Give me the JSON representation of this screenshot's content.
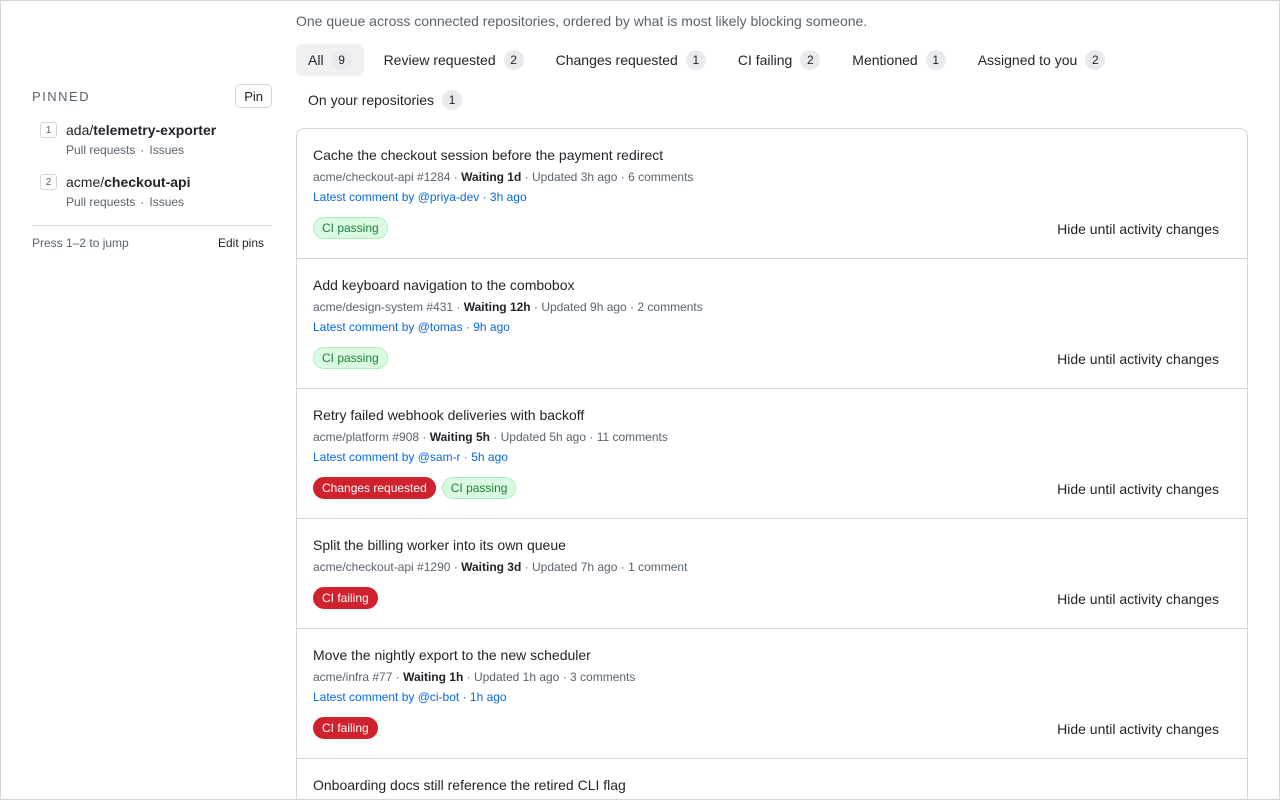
{
  "header": {
    "subtitle": "One queue across connected repositories, ordered by what is most likely blocking someone."
  },
  "tabs": [
    {
      "label": "All",
      "count": "9",
      "active": true
    },
    {
      "label": "Review requested",
      "count": "2"
    },
    {
      "label": "Changes requested",
      "count": "1"
    },
    {
      "label": "CI failing",
      "count": "2"
    },
    {
      "label": "Mentioned",
      "count": "1"
    },
    {
      "label": "Assigned to you",
      "count": "2"
    },
    {
      "label": "On your repositories",
      "count": "1"
    }
  ],
  "sidebar": {
    "pinned_title": "PINNED",
    "pin_button": "Pin",
    "items": [
      {
        "number": "1",
        "owner": "ada/",
        "name": "telemetry-exporter",
        "link1": "Pull requests",
        "sep": "·",
        "link2": "Issues"
      },
      {
        "number": "2",
        "owner": "acme/",
        "name": "checkout-api",
        "link1": "Pull requests",
        "sep": "·",
        "link2": "Issues"
      }
    ],
    "jump_hint": "Press 1–2 to jump",
    "edit_pins": "Edit pins"
  },
  "queue": {
    "hide_label": "Hide until activity changes",
    "items": [
      {
        "title": "Cache the checkout session before the payment redirect",
        "repo": "acme/checkout-api #1284",
        "waiting": "Waiting 1d",
        "updated": "Updated 3h ago",
        "comments": "6 comments",
        "latest": "Latest comment by @priya-dev · 3h ago",
        "badges": [
          {
            "label": "CI passing",
            "kind": "pass"
          }
        ]
      },
      {
        "title": "Add keyboard navigation to the combobox",
        "repo": "acme/design-system #431",
        "waiting": "Waiting 12h",
        "updated": "Updated 9h ago",
        "comments": "2 comments",
        "latest": "Latest comment by @tomas · 9h ago",
        "badges": [
          {
            "label": "CI passing",
            "kind": "pass"
          }
        ]
      },
      {
        "title": "Retry failed webhook deliveries with backoff",
        "repo": "acme/platform #908",
        "waiting": "Waiting 5h",
        "updated": "Updated 5h ago",
        "comments": "11 comments",
        "latest": "Latest comment by @sam-r · 5h ago",
        "badges": [
          {
            "label": "Changes requested",
            "kind": "fail"
          },
          {
            "label": "CI passing",
            "kind": "pass"
          }
        ]
      },
      {
        "title": "Split the billing worker into its own queue",
        "repo": "acme/checkout-api #1290",
        "waiting": "Waiting 3d",
        "updated": "Updated 7h ago",
        "comments": "1 comment",
        "latest": "",
        "badges": [
          {
            "label": "CI failing",
            "kind": "fail"
          }
        ]
      },
      {
        "title": "Move the nightly export to the new scheduler",
        "repo": "acme/infra #77",
        "waiting": "Waiting 1h",
        "updated": "Updated 1h ago",
        "comments": "3 comments",
        "latest": "Latest comment by @ci-bot · 1h ago",
        "badges": [
          {
            "label": "CI failing",
            "kind": "fail"
          }
        ]
      },
      {
        "title": "Onboarding docs still reference the retired CLI flag",
        "repo": "",
        "waiting": "",
        "updated": "",
        "comments": "",
        "latest": "",
        "badges": []
      }
    ]
  },
  "colors": {
    "accent_link": "#0969da",
    "danger": "#cf222e",
    "success": "#1a7f37"
  }
}
